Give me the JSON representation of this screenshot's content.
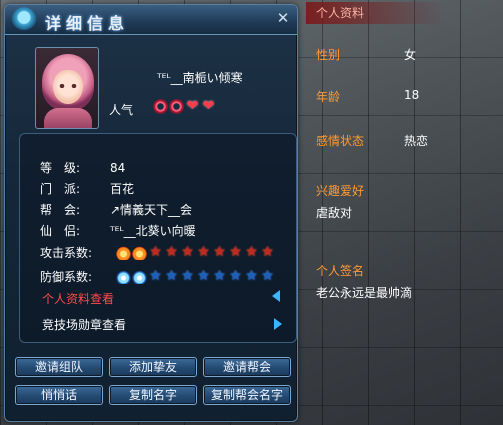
{
  "dialog": {
    "title": "详细信息",
    "close_symbol": "✕"
  },
  "character": {
    "name": "ᵀᴱᴸ__南栀い倾寒",
    "popularity_label": "人气",
    "popularity_icons": [
      "ring-icon",
      "ring-icon",
      "heart-icon",
      "heart-icon"
    ]
  },
  "info": {
    "level": {
      "label": "等　级:",
      "value": "84"
    },
    "school": {
      "label": "门　派:",
      "value": "百花"
    },
    "guild": {
      "label": "帮　会:",
      "value": "↗情義天下__会"
    },
    "partner": {
      "label": "仙　侣:",
      "value": "ᵀᴱᴸ__北葵い向暖"
    }
  },
  "stats": {
    "attack": {
      "label": "攻击系数:",
      "filled": 2,
      "total": 10,
      "filled_icon": "fire-orb-icon",
      "empty_icon": "red-star-icon"
    },
    "defense": {
      "label": "防御系数:",
      "filled": 2,
      "total": 10,
      "filled_icon": "water-orb-icon",
      "empty_icon": "blue-star-icon"
    }
  },
  "links": {
    "profile": "个人资料查看",
    "arena": "竞技场勋章查看"
  },
  "buttons": {
    "invite_team": "邀请组队",
    "add_friend": "添加挚友",
    "invite_guild": "邀请帮会",
    "whisper": "悄悄话",
    "copy_name": "复制名字",
    "copy_guild_name": "复制帮会名字"
  },
  "profile": {
    "header": "个人资料",
    "gender_label": "性别",
    "gender_value": "女",
    "age_label": "年龄",
    "age_value": "18",
    "relationship_label": "感情状态",
    "relationship_value": "热恋",
    "hobby_label": "兴趣爱好",
    "hobby_value": "虐敌对",
    "signature_label": "个人签名",
    "signature_value": "老公永远是最帅滴"
  },
  "colors": {
    "label_orange": "#ff9a32",
    "link_red": "#ff4a4a",
    "accent_blue": "#39b8ff"
  }
}
